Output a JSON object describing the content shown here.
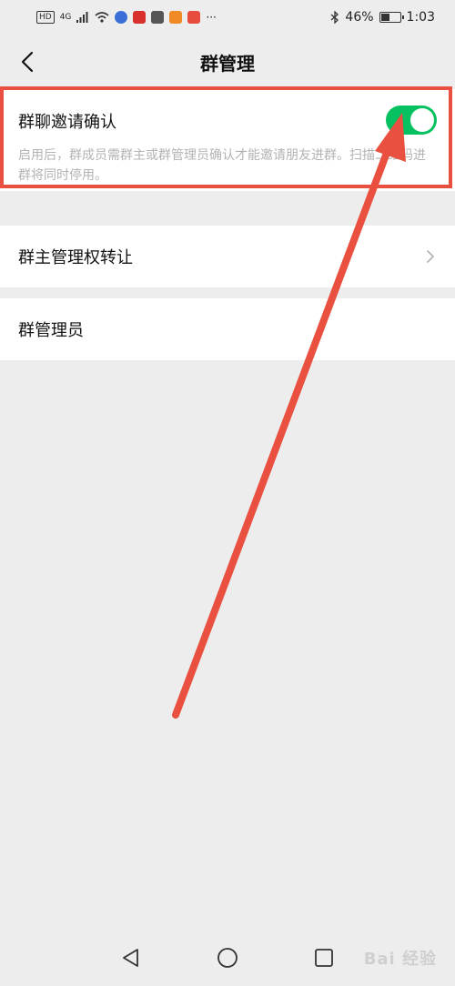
{
  "status_bar": {
    "hd_label": "HD",
    "network_label": "4G",
    "battery_text": "46%",
    "time": "1:03",
    "battery_level": 0.46
  },
  "header": {
    "title": "群管理",
    "back_icon": "chevron-left-icon"
  },
  "invite_confirm": {
    "label": "群聊邀请确认",
    "description": "启用后，群成员需群主或群管理员确认才能邀请朋友进群。扫描二维码进群将同时停用。",
    "enabled": true,
    "toggle_color": "#07c160"
  },
  "transfer_owner": {
    "label": "群主管理权转让",
    "icon": "chevron-right-icon"
  },
  "admins": {
    "label": "群管理员"
  },
  "annotation": {
    "color": "#e9503f"
  },
  "system_nav": {
    "back_icon": "triangle-back-icon",
    "home_icon": "circle-home-icon",
    "recents_icon": "square-recents-icon"
  },
  "watermark": "Bai 经验"
}
